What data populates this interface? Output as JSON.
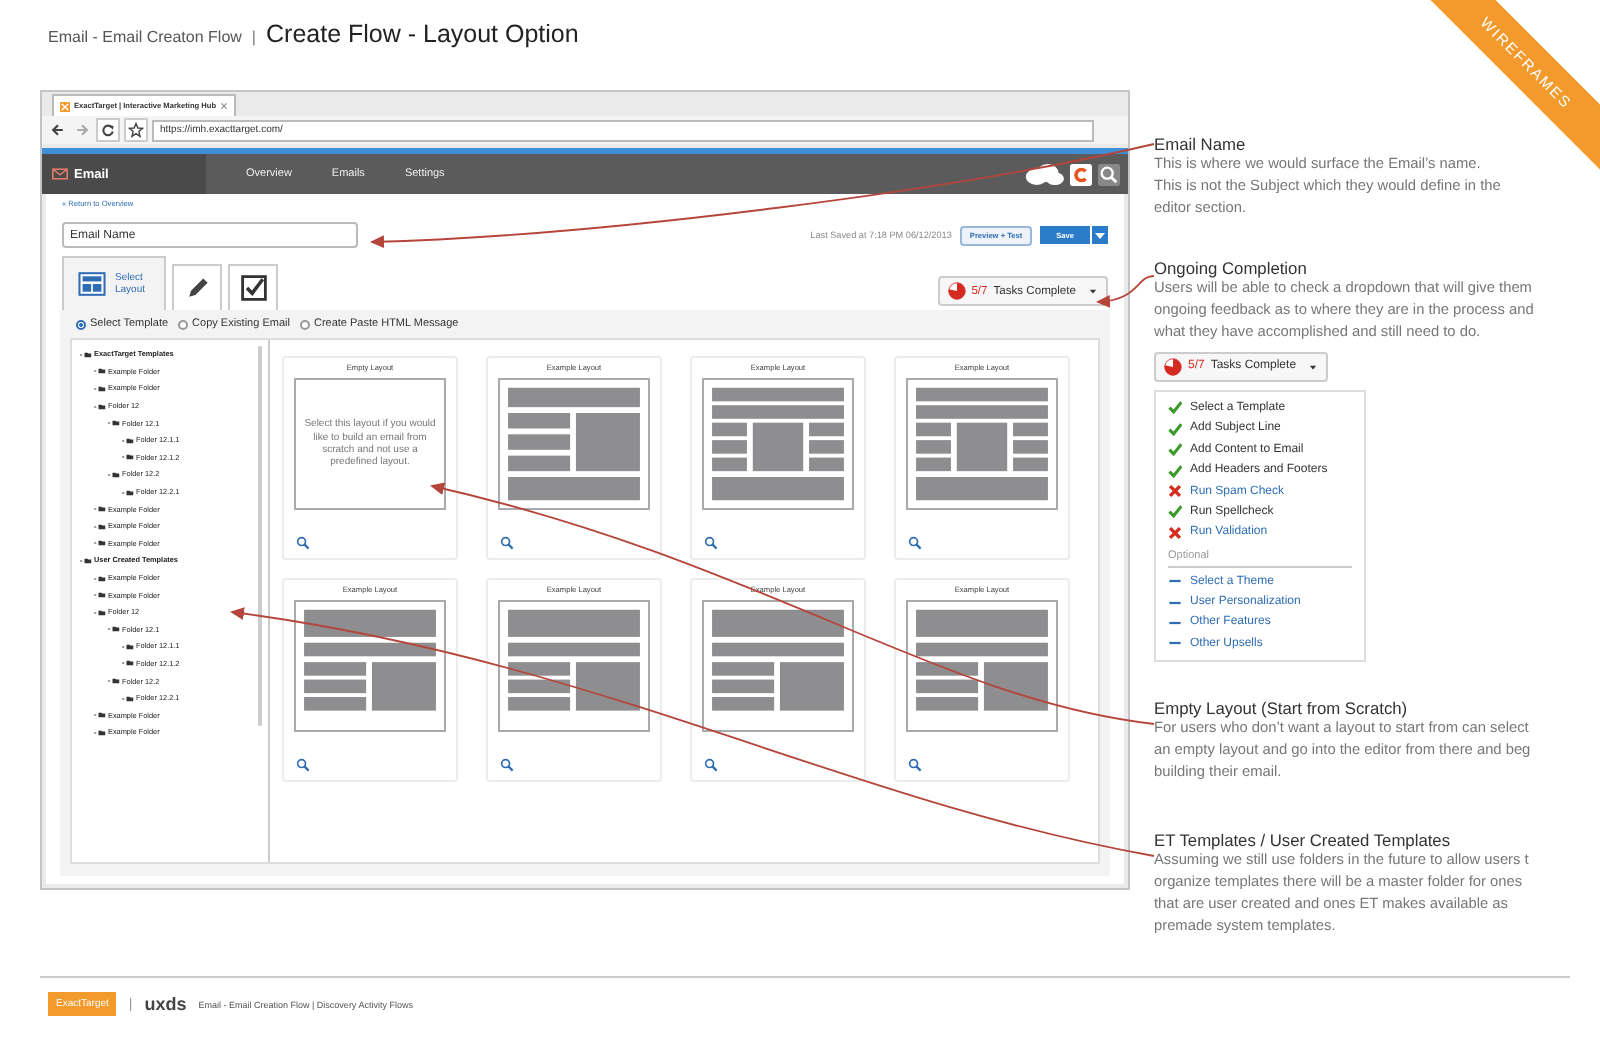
{
  "header": {
    "flow": "Email - Email Creaton Flow",
    "separator": "|",
    "title": "Create Flow - Layout Option"
  },
  "ribbon": "WIREFRAMES",
  "browser": {
    "tab_title": "ExactTarget | Interactive Marketing Hub",
    "url": "https://imh.exacttarget.com/"
  },
  "app_nav": {
    "brand": "Email",
    "items": [
      "Overview",
      "Emails",
      "Settings"
    ]
  },
  "editor": {
    "return_link": "« Return to Overview",
    "email_name": "Email Name",
    "last_saved": "Last Saved at 7:18 PM 06/12/2013",
    "preview_button": "Preview + Test",
    "save_button": "Save",
    "steps": [
      {
        "kind": "layout",
        "label": "Select Layout",
        "selected": true
      },
      {
        "kind": "edit",
        "selected": false
      },
      {
        "kind": "review",
        "selected": false
      }
    ],
    "tasks": {
      "count": "5/7",
      "label": "Tasks Complete"
    },
    "options": [
      {
        "label": "Select Template",
        "selected": true
      },
      {
        "label": "Copy Existing Email",
        "selected": false
      },
      {
        "label": "Create Paste HTML Message",
        "selected": false
      }
    ],
    "tree": [
      {
        "label": "ExactTarget Templates",
        "children": [
          {
            "label": "Example Folder"
          },
          {
            "label": "Example Folder"
          },
          {
            "label": "Folder 12",
            "children": [
              {
                "label": "Folder 12.1",
                "children": [
                  {
                    "label": "Folder 12.1.1"
                  },
                  {
                    "label": "Folder 12.1.2"
                  }
                ]
              },
              {
                "label": "Folder 12.2",
                "children": [
                  {
                    "label": "Folder 12.2.1"
                  }
                ]
              }
            ]
          },
          {
            "label": "Example Folder"
          },
          {
            "label": "Example Folder"
          },
          {
            "label": "Example Folder"
          }
        ]
      },
      {
        "label": "User Created Templates",
        "children": [
          {
            "label": "Example Folder"
          },
          {
            "label": "Example Folder"
          },
          {
            "label": "Folder 12",
            "children": [
              {
                "label": "Folder 12.1",
                "children": [
                  {
                    "label": "Folder 12.1.1"
                  },
                  {
                    "label": "Folder 12.1.2"
                  }
                ]
              },
              {
                "label": "Folder 12.2",
                "children": [
                  {
                    "label": "Folder 12.2.1"
                  }
                ]
              }
            ]
          },
          {
            "label": "Example Folder"
          },
          {
            "label": "Example Folder"
          }
        ]
      }
    ],
    "layouts": [
      {
        "title": "Empty Layout",
        "kind": "empty",
        "text": "Select this layout if you would like to build an email from scratch and not use a predefined layout."
      },
      {
        "title": "Example Layout",
        "kind": "sidebar-right"
      },
      {
        "title": "Example Layout",
        "kind": "three-column"
      },
      {
        "title": "Example Layout",
        "kind": "three-column"
      },
      {
        "title": "Example Layout",
        "kind": "split"
      },
      {
        "title": "Example Layout",
        "kind": "split"
      },
      {
        "title": "Example Layout",
        "kind": "split"
      },
      {
        "title": "Example Layout",
        "kind": "split"
      }
    ]
  },
  "notes": [
    {
      "kind": "text",
      "title": "Email Name",
      "text": "This is where we would surface the Email’s name.\nThis is not the Subject which they would define in the\neditor section."
    },
    {
      "kind": "checklist",
      "title": "Ongoing Completion",
      "text": "Users will be able to check a dropdown that will give them\nongoing feedback as to where they are in the process and\nwhat they have accomplished and still need to do.",
      "tasks": {
        "count": "5/7",
        "label": "Tasks Complete"
      },
      "items": [
        {
          "label": "Select a Template",
          "kind": "done"
        },
        {
          "label": "Add Subject Line",
          "kind": "done"
        },
        {
          "label": "Add Content to Email",
          "kind": "done"
        },
        {
          "label": "Add Headers and Footers",
          "kind": "done"
        },
        {
          "label": "Run Spam Check",
          "kind": "failed"
        },
        {
          "label": "Run Spellcheck",
          "kind": "done"
        },
        {
          "label": "Run Validation",
          "kind": "failed"
        }
      ],
      "optional_heading": "Optional",
      "optional_items": [
        {
          "label": "Select a Theme",
          "kind": "optional"
        },
        {
          "label": "User Personalization",
          "kind": "optional"
        },
        {
          "label": "Other Features",
          "kind": "optional"
        },
        {
          "label": "Other Upsells",
          "kind": "optional"
        }
      ]
    },
    {
      "kind": "text",
      "title": "Empty Layout (Start from Scratch)",
      "text": "For users who don’t want a layout to start from can select\nan empty layout and go into the editor from there and beg\nbuilding their email."
    },
    {
      "kind": "text",
      "title": "ET Templates / User Created Templates",
      "text": "Assuming we still use folders in the future to allow users t\norganize templates there will be a master folder for ones\nthat are user created and ones ET makes available as\npremade system templates."
    }
  ],
  "footer": {
    "logo": "ExactTarget",
    "separator": "|",
    "brand": "uxds",
    "text": "Email - Email Creation Flow | Discovery Activity Flows"
  }
}
